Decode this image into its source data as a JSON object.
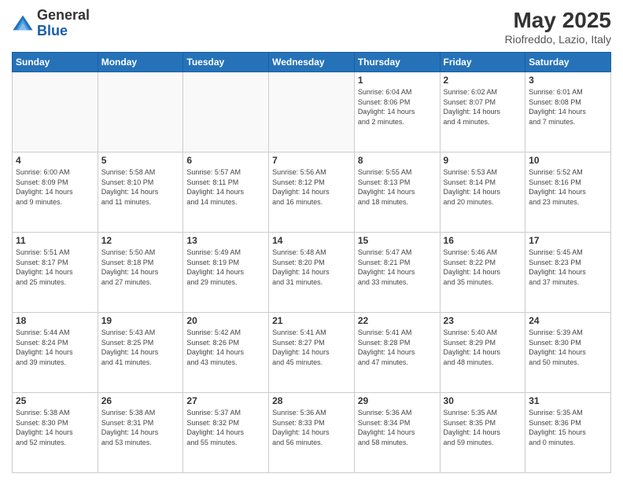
{
  "logo": {
    "general": "General",
    "blue": "Blue"
  },
  "title": "May 2025",
  "location": "Riofreddo, Lazio, Italy",
  "days_header": [
    "Sunday",
    "Monday",
    "Tuesday",
    "Wednesday",
    "Thursday",
    "Friday",
    "Saturday"
  ],
  "weeks": [
    [
      {
        "day": "",
        "info": ""
      },
      {
        "day": "",
        "info": ""
      },
      {
        "day": "",
        "info": ""
      },
      {
        "day": "",
        "info": ""
      },
      {
        "day": "1",
        "info": "Sunrise: 6:04 AM\nSunset: 8:06 PM\nDaylight: 14 hours\nand 2 minutes."
      },
      {
        "day": "2",
        "info": "Sunrise: 6:02 AM\nSunset: 8:07 PM\nDaylight: 14 hours\nand 4 minutes."
      },
      {
        "day": "3",
        "info": "Sunrise: 6:01 AM\nSunset: 8:08 PM\nDaylight: 14 hours\nand 7 minutes."
      }
    ],
    [
      {
        "day": "4",
        "info": "Sunrise: 6:00 AM\nSunset: 8:09 PM\nDaylight: 14 hours\nand 9 minutes."
      },
      {
        "day": "5",
        "info": "Sunrise: 5:58 AM\nSunset: 8:10 PM\nDaylight: 14 hours\nand 11 minutes."
      },
      {
        "day": "6",
        "info": "Sunrise: 5:57 AM\nSunset: 8:11 PM\nDaylight: 14 hours\nand 14 minutes."
      },
      {
        "day": "7",
        "info": "Sunrise: 5:56 AM\nSunset: 8:12 PM\nDaylight: 14 hours\nand 16 minutes."
      },
      {
        "day": "8",
        "info": "Sunrise: 5:55 AM\nSunset: 8:13 PM\nDaylight: 14 hours\nand 18 minutes."
      },
      {
        "day": "9",
        "info": "Sunrise: 5:53 AM\nSunset: 8:14 PM\nDaylight: 14 hours\nand 20 minutes."
      },
      {
        "day": "10",
        "info": "Sunrise: 5:52 AM\nSunset: 8:16 PM\nDaylight: 14 hours\nand 23 minutes."
      }
    ],
    [
      {
        "day": "11",
        "info": "Sunrise: 5:51 AM\nSunset: 8:17 PM\nDaylight: 14 hours\nand 25 minutes."
      },
      {
        "day": "12",
        "info": "Sunrise: 5:50 AM\nSunset: 8:18 PM\nDaylight: 14 hours\nand 27 minutes."
      },
      {
        "day": "13",
        "info": "Sunrise: 5:49 AM\nSunset: 8:19 PM\nDaylight: 14 hours\nand 29 minutes."
      },
      {
        "day": "14",
        "info": "Sunrise: 5:48 AM\nSunset: 8:20 PM\nDaylight: 14 hours\nand 31 minutes."
      },
      {
        "day": "15",
        "info": "Sunrise: 5:47 AM\nSunset: 8:21 PM\nDaylight: 14 hours\nand 33 minutes."
      },
      {
        "day": "16",
        "info": "Sunrise: 5:46 AM\nSunset: 8:22 PM\nDaylight: 14 hours\nand 35 minutes."
      },
      {
        "day": "17",
        "info": "Sunrise: 5:45 AM\nSunset: 8:23 PM\nDaylight: 14 hours\nand 37 minutes."
      }
    ],
    [
      {
        "day": "18",
        "info": "Sunrise: 5:44 AM\nSunset: 8:24 PM\nDaylight: 14 hours\nand 39 minutes."
      },
      {
        "day": "19",
        "info": "Sunrise: 5:43 AM\nSunset: 8:25 PM\nDaylight: 14 hours\nand 41 minutes."
      },
      {
        "day": "20",
        "info": "Sunrise: 5:42 AM\nSunset: 8:26 PM\nDaylight: 14 hours\nand 43 minutes."
      },
      {
        "day": "21",
        "info": "Sunrise: 5:41 AM\nSunset: 8:27 PM\nDaylight: 14 hours\nand 45 minutes."
      },
      {
        "day": "22",
        "info": "Sunrise: 5:41 AM\nSunset: 8:28 PM\nDaylight: 14 hours\nand 47 minutes."
      },
      {
        "day": "23",
        "info": "Sunrise: 5:40 AM\nSunset: 8:29 PM\nDaylight: 14 hours\nand 48 minutes."
      },
      {
        "day": "24",
        "info": "Sunrise: 5:39 AM\nSunset: 8:30 PM\nDaylight: 14 hours\nand 50 minutes."
      }
    ],
    [
      {
        "day": "25",
        "info": "Sunrise: 5:38 AM\nSunset: 8:30 PM\nDaylight: 14 hours\nand 52 minutes."
      },
      {
        "day": "26",
        "info": "Sunrise: 5:38 AM\nSunset: 8:31 PM\nDaylight: 14 hours\nand 53 minutes."
      },
      {
        "day": "27",
        "info": "Sunrise: 5:37 AM\nSunset: 8:32 PM\nDaylight: 14 hours\nand 55 minutes."
      },
      {
        "day": "28",
        "info": "Sunrise: 5:36 AM\nSunset: 8:33 PM\nDaylight: 14 hours\nand 56 minutes."
      },
      {
        "day": "29",
        "info": "Sunrise: 5:36 AM\nSunset: 8:34 PM\nDaylight: 14 hours\nand 58 minutes."
      },
      {
        "day": "30",
        "info": "Sunrise: 5:35 AM\nSunset: 8:35 PM\nDaylight: 14 hours\nand 59 minutes."
      },
      {
        "day": "31",
        "info": "Sunrise: 5:35 AM\nSunset: 8:36 PM\nDaylight: 15 hours\nand 0 minutes."
      }
    ]
  ]
}
